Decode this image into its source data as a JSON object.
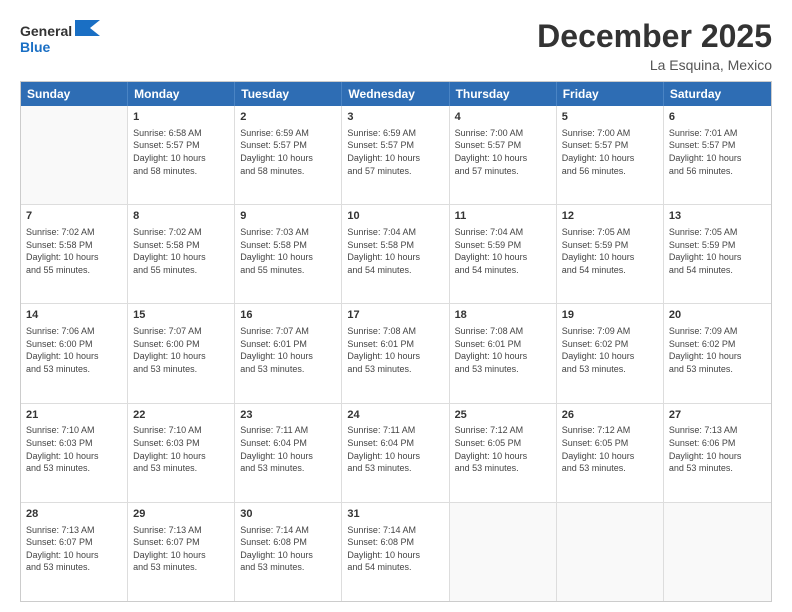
{
  "logo": {
    "general": "General",
    "blue": "Blue"
  },
  "title": "December 2025",
  "subtitle": "La Esquina, Mexico",
  "header_days": [
    "Sunday",
    "Monday",
    "Tuesday",
    "Wednesday",
    "Thursday",
    "Friday",
    "Saturday"
  ],
  "weeks": [
    [
      {
        "day": "",
        "info": ""
      },
      {
        "day": "1",
        "info": "Sunrise: 6:58 AM\nSunset: 5:57 PM\nDaylight: 10 hours\nand 58 minutes."
      },
      {
        "day": "2",
        "info": "Sunrise: 6:59 AM\nSunset: 5:57 PM\nDaylight: 10 hours\nand 58 minutes."
      },
      {
        "day": "3",
        "info": "Sunrise: 6:59 AM\nSunset: 5:57 PM\nDaylight: 10 hours\nand 57 minutes."
      },
      {
        "day": "4",
        "info": "Sunrise: 7:00 AM\nSunset: 5:57 PM\nDaylight: 10 hours\nand 57 minutes."
      },
      {
        "day": "5",
        "info": "Sunrise: 7:00 AM\nSunset: 5:57 PM\nDaylight: 10 hours\nand 56 minutes."
      },
      {
        "day": "6",
        "info": "Sunrise: 7:01 AM\nSunset: 5:57 PM\nDaylight: 10 hours\nand 56 minutes."
      }
    ],
    [
      {
        "day": "7",
        "info": "Sunrise: 7:02 AM\nSunset: 5:58 PM\nDaylight: 10 hours\nand 55 minutes."
      },
      {
        "day": "8",
        "info": "Sunrise: 7:02 AM\nSunset: 5:58 PM\nDaylight: 10 hours\nand 55 minutes."
      },
      {
        "day": "9",
        "info": "Sunrise: 7:03 AM\nSunset: 5:58 PM\nDaylight: 10 hours\nand 55 minutes."
      },
      {
        "day": "10",
        "info": "Sunrise: 7:04 AM\nSunset: 5:58 PM\nDaylight: 10 hours\nand 54 minutes."
      },
      {
        "day": "11",
        "info": "Sunrise: 7:04 AM\nSunset: 5:59 PM\nDaylight: 10 hours\nand 54 minutes."
      },
      {
        "day": "12",
        "info": "Sunrise: 7:05 AM\nSunset: 5:59 PM\nDaylight: 10 hours\nand 54 minutes."
      },
      {
        "day": "13",
        "info": "Sunrise: 7:05 AM\nSunset: 5:59 PM\nDaylight: 10 hours\nand 54 minutes."
      }
    ],
    [
      {
        "day": "14",
        "info": "Sunrise: 7:06 AM\nSunset: 6:00 PM\nDaylight: 10 hours\nand 53 minutes."
      },
      {
        "day": "15",
        "info": "Sunrise: 7:07 AM\nSunset: 6:00 PM\nDaylight: 10 hours\nand 53 minutes."
      },
      {
        "day": "16",
        "info": "Sunrise: 7:07 AM\nSunset: 6:01 PM\nDaylight: 10 hours\nand 53 minutes."
      },
      {
        "day": "17",
        "info": "Sunrise: 7:08 AM\nSunset: 6:01 PM\nDaylight: 10 hours\nand 53 minutes."
      },
      {
        "day": "18",
        "info": "Sunrise: 7:08 AM\nSunset: 6:01 PM\nDaylight: 10 hours\nand 53 minutes."
      },
      {
        "day": "19",
        "info": "Sunrise: 7:09 AM\nSunset: 6:02 PM\nDaylight: 10 hours\nand 53 minutes."
      },
      {
        "day": "20",
        "info": "Sunrise: 7:09 AM\nSunset: 6:02 PM\nDaylight: 10 hours\nand 53 minutes."
      }
    ],
    [
      {
        "day": "21",
        "info": "Sunrise: 7:10 AM\nSunset: 6:03 PM\nDaylight: 10 hours\nand 53 minutes."
      },
      {
        "day": "22",
        "info": "Sunrise: 7:10 AM\nSunset: 6:03 PM\nDaylight: 10 hours\nand 53 minutes."
      },
      {
        "day": "23",
        "info": "Sunrise: 7:11 AM\nSunset: 6:04 PM\nDaylight: 10 hours\nand 53 minutes."
      },
      {
        "day": "24",
        "info": "Sunrise: 7:11 AM\nSunset: 6:04 PM\nDaylight: 10 hours\nand 53 minutes."
      },
      {
        "day": "25",
        "info": "Sunrise: 7:12 AM\nSunset: 6:05 PM\nDaylight: 10 hours\nand 53 minutes."
      },
      {
        "day": "26",
        "info": "Sunrise: 7:12 AM\nSunset: 6:05 PM\nDaylight: 10 hours\nand 53 minutes."
      },
      {
        "day": "27",
        "info": "Sunrise: 7:13 AM\nSunset: 6:06 PM\nDaylight: 10 hours\nand 53 minutes."
      }
    ],
    [
      {
        "day": "28",
        "info": "Sunrise: 7:13 AM\nSunset: 6:07 PM\nDaylight: 10 hours\nand 53 minutes."
      },
      {
        "day": "29",
        "info": "Sunrise: 7:13 AM\nSunset: 6:07 PM\nDaylight: 10 hours\nand 53 minutes."
      },
      {
        "day": "30",
        "info": "Sunrise: 7:14 AM\nSunset: 6:08 PM\nDaylight: 10 hours\nand 53 minutes."
      },
      {
        "day": "31",
        "info": "Sunrise: 7:14 AM\nSunset: 6:08 PM\nDaylight: 10 hours\nand 54 minutes."
      },
      {
        "day": "",
        "info": ""
      },
      {
        "day": "",
        "info": ""
      },
      {
        "day": "",
        "info": ""
      }
    ]
  ]
}
